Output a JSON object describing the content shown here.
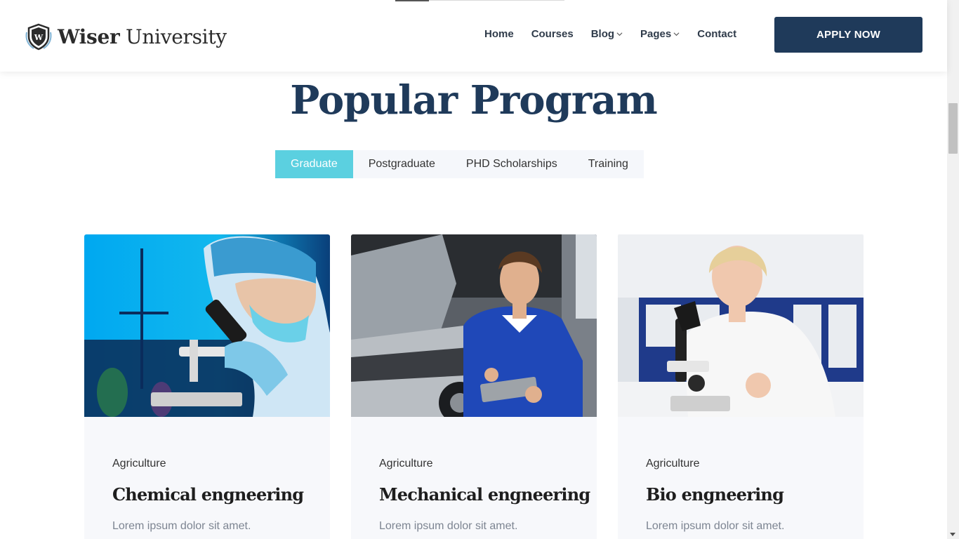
{
  "brand": {
    "name_bold": "Wiser",
    "name_regular": "University",
    "logo_letter": "W"
  },
  "nav": {
    "items": [
      {
        "label": "Home",
        "dropdown": false
      },
      {
        "label": "Courses",
        "dropdown": false
      },
      {
        "label": "Blog",
        "dropdown": true
      },
      {
        "label": "Pages",
        "dropdown": true
      },
      {
        "label": "Contact",
        "dropdown": false
      }
    ],
    "cta_label": "APPLY NOW"
  },
  "section": {
    "title": "Popular Program"
  },
  "tabs": [
    {
      "label": "Graduate",
      "active": true
    },
    {
      "label": "Postgraduate",
      "active": false
    },
    {
      "label": "PHD Scholarships",
      "active": false
    },
    {
      "label": "Training",
      "active": false
    }
  ],
  "cards": [
    {
      "category": "Agriculture",
      "title": "Chemical engneering",
      "desc": "Lorem ipsum dolor sit amet.",
      "image": "lab-scientist-microscope-photo"
    },
    {
      "category": "Agriculture",
      "title": "Mechanical engneering",
      "desc": "Lorem ipsum dolor sit amet.",
      "image": "mechanic-with-clipboard-photo"
    },
    {
      "category": "Agriculture",
      "title": "Bio engneering",
      "desc": "Lorem ipsum dolor sit amet.",
      "image": "woman-scientist-microscope-photo"
    }
  ],
  "colors": {
    "primary": "#1f3a5a",
    "accent": "#5bd0e0",
    "card_bg": "#f7f8fb"
  }
}
